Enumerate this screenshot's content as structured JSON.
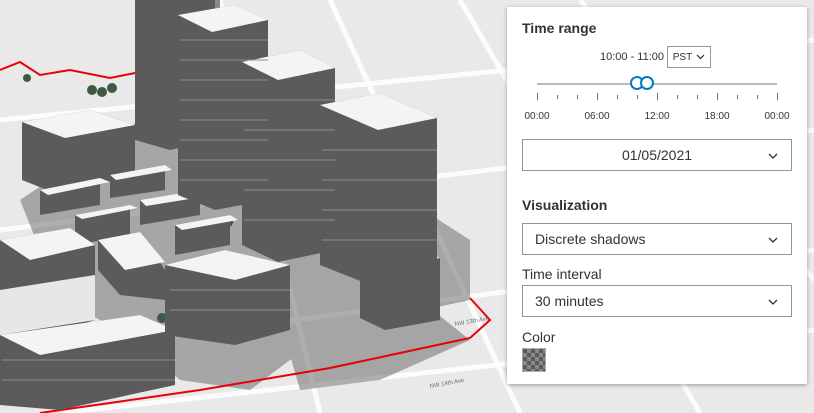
{
  "map": {
    "street_labels": [
      "NW 13th Ave",
      "NW 14th Ave"
    ],
    "colors": {
      "boundary": "#e8000b",
      "building_dark": "#5b5b5b",
      "building_roof": "#f4f4f4"
    }
  },
  "panel": {
    "time_range": {
      "title": "Time range",
      "range_text": "10:00 - 11:00",
      "timezone": "PST",
      "slider_start_hours": 10,
      "slider_end_hours": 11,
      "ticks": [
        "00:00",
        "06:00",
        "12:00",
        "18:00",
        "00:00"
      ]
    },
    "date": {
      "value": "01/05/2021"
    },
    "visualization": {
      "title": "Visualization",
      "selected": "Discrete shadows"
    },
    "time_interval": {
      "label": "Time interval",
      "selected": "30 minutes"
    },
    "color": {
      "label": "Color",
      "value": "#5a5a5a"
    },
    "accent": "#0079c1"
  }
}
